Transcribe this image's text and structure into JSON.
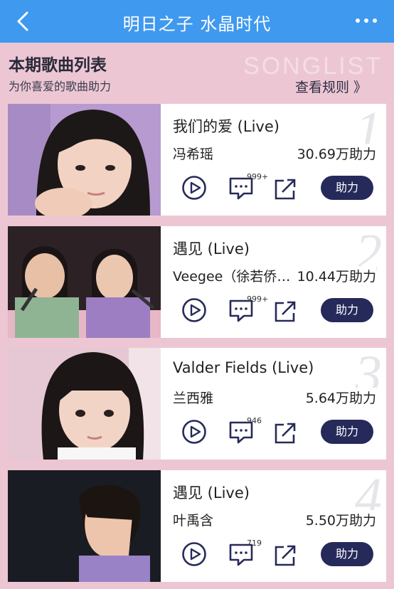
{
  "nav": {
    "title": "明日之子 水晶时代"
  },
  "header": {
    "title": "本期歌曲列表",
    "subtitle": "为你喜爱的歌曲助力",
    "watermark": "SONGLIST",
    "rules_link": "查看规则 》"
  },
  "songs": [
    {
      "rank": "1",
      "title": "我们的爱 (Live)",
      "singer": "冯希瑶",
      "votes": "30.69万助力",
      "comments": "999+",
      "help_label": "助力"
    },
    {
      "rank": "2",
      "title": "遇见 (Live)",
      "singer": "Veegee（徐若侨…",
      "votes": "10.44万助力",
      "comments": "999+",
      "help_label": "助力"
    },
    {
      "rank": "3",
      "title": "Valder Fields (Live)",
      "singer": "兰西雅",
      "votes": "5.64万助力",
      "comments": "946",
      "help_label": "助力"
    },
    {
      "rank": "4",
      "title": "遇见 (Live)",
      "singer": "叶禹含",
      "votes": "5.50万助力",
      "comments": "719",
      "help_label": "助力"
    }
  ],
  "colors": {
    "nav": "#3f99ee",
    "background": "#ecc7d3",
    "button": "#262a5a"
  }
}
